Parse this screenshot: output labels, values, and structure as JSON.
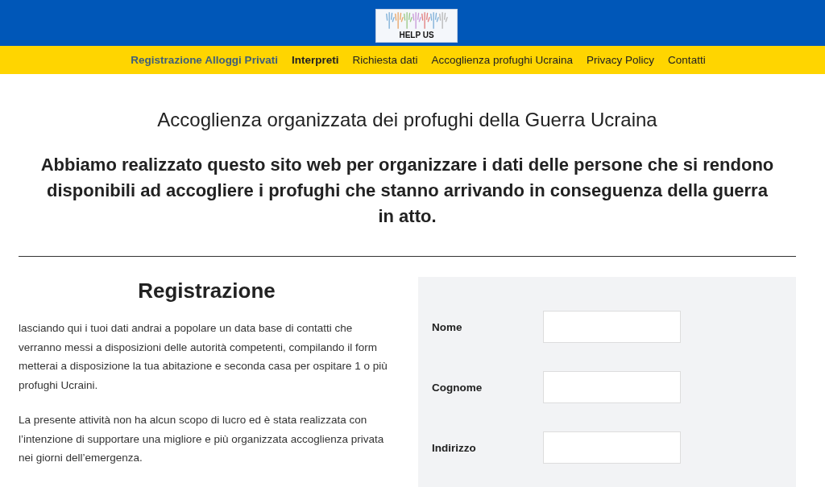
{
  "header": {
    "logo_text": "HELP US"
  },
  "nav": [
    {
      "label": "Registrazione Alloggi Privati",
      "selected": true,
      "bold": true
    },
    {
      "label": "Interpreti",
      "selected": false,
      "bold": true
    },
    {
      "label": "Richiesta dati",
      "selected": false,
      "bold": false
    },
    {
      "label": "Accoglienza profughi Ucraina",
      "selected": false,
      "bold": false
    },
    {
      "label": "Privacy Policy",
      "selected": false,
      "bold": false
    },
    {
      "label": "Contatti",
      "selected": false,
      "bold": false
    }
  ],
  "title": "Accoglienza organizzata dei profughi della Guerra Ucraina",
  "subtitle": "Abbiamo realizzato questo sito web per organizzare i dati delle persone che si rendono disponibili ad accogliere i profughi che stanno arrivando in conseguenza della guerra in atto.",
  "registration": {
    "heading": "Registrazione",
    "paragraphs": [
      "lasciando qui i tuoi dati andrai a popolare un data base di contatti che verranno messi a disposizioni delle autorità competenti, compilando il form metterai a disposizione la tua abitazione e seconda casa per ospitare 1 o più profughi Ucraini.",
      "La presente attività non ha alcun scopo di lucro ed è stata realizzata con l’intenzione di supportare una migliore e più organizzata accoglienza privata nei giorni dell’emergenza."
    ]
  },
  "form": {
    "fields": [
      {
        "label": "Nome"
      },
      {
        "label": "Cognome"
      },
      {
        "label": "Indirizzo"
      }
    ]
  }
}
